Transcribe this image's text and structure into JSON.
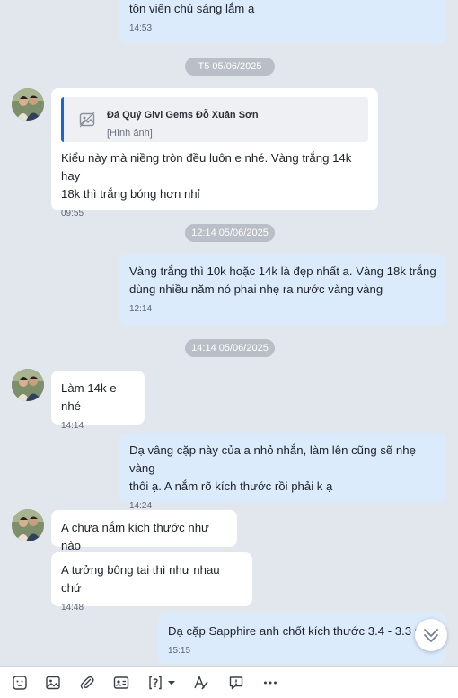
{
  "messages": {
    "m1": {
      "text": "tôn viên chủ sáng lắm ạ",
      "time": "14:53"
    },
    "m2": {
      "reply_sender": "Đá Quý Givi Gems Đỗ Xuân Sơn",
      "reply_label": "[Hình ảnh]",
      "text": "Kiểu này mà niềng tròn đều luôn e nhé. Vàng trắng 14k hay\n18k thì trắng bóng hơn nhỉ",
      "time": "09:55"
    },
    "m3": {
      "text": "Vàng trắng thì 10k hoặc 14k là đẹp nhất a. Vàng 18k trắng\ndùng nhiều năm nó phai nhẹ ra nước vàng vàng",
      "time": "12:14"
    },
    "m4": {
      "text": "Làm 14k e nhé",
      "time": "14:14"
    },
    "m5": {
      "text": "Dạ vâng cặp này của a nhỏ nhắn, làm lên cũng sẽ nhẹ vàng\nthôi ạ. A nắm rõ kích thước rồi phải k ạ",
      "time": "14:24"
    },
    "m6": {
      "text": "A chưa nắm kích thước như nào"
    },
    "m7": {
      "text": "A tưởng bông tai thì như nhau chứ",
      "time": "14:48"
    },
    "m8": {
      "text": "Dạ cặp Sapphire anh chốt kích thước 3.4 - 3.3 m",
      "time": "15:15"
    }
  },
  "date_separators": {
    "d1": "T5 05/06/2025",
    "d2": "12:14 05/06/2025",
    "d3": "14:14 05/06/2025"
  },
  "toolbar_icons": [
    "sticker-icon",
    "image-icon",
    "attachment-icon",
    "contact-card-icon",
    "quick-message-icon",
    "chevron-down-icon",
    "format-text-icon",
    "reminder-icon",
    "more-icon"
  ],
  "colors": {
    "incoming_bg": "#ffffff",
    "outgoing_bg": "#dbebfc",
    "chat_bg": "#e2e7ee",
    "accent": "#1668d8"
  }
}
